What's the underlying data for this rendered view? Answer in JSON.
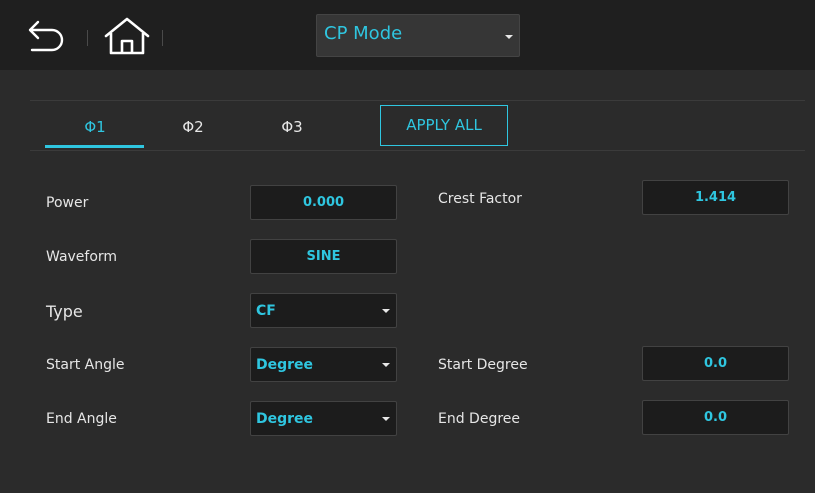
{
  "header": {
    "back_icon": "back-arrow-icon",
    "home_icon": "home-icon",
    "mode_select": {
      "value": "CP Mode"
    }
  },
  "tabs": [
    {
      "label": "Φ1",
      "active": true
    },
    {
      "label": "Φ2",
      "active": false
    },
    {
      "label": "Φ3",
      "active": false
    }
  ],
  "apply_all_label": "APPLY ALL",
  "form": {
    "power": {
      "label": "Power",
      "value": "0.000"
    },
    "crest_factor": {
      "label": "Crest Factor",
      "value": "1.414"
    },
    "waveform": {
      "label": "Waveform",
      "value": "SINE"
    },
    "type": {
      "label": "Type",
      "value": "CF"
    },
    "start_angle": {
      "label": "Start Angle",
      "value": "Degree"
    },
    "start_degree": {
      "label": "Start Degree",
      "value": "0.0"
    },
    "end_angle": {
      "label": "End Angle",
      "value": "Degree"
    },
    "end_degree": {
      "label": "End Degree",
      "value": "0.0"
    }
  },
  "colors": {
    "accent": "#2fc6e0",
    "background": "#2b2b2b",
    "topbar": "#1f1f1f"
  }
}
